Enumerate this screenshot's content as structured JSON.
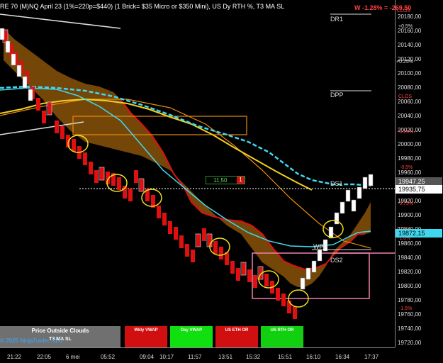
{
  "header": {
    "title": "RE 70 (M)NQ April 23 (1%=220p=$440) (1 Brick= $35 Micro or $350 Mini), US Dy RTH %, T3 MA SL",
    "pnl": "W -1.28% = -269.50"
  },
  "y_axis": {
    "ticks": [
      "20180,00",
      "20160,00",
      "20140,00",
      "20120,00",
      "20100,00",
      "20080,00",
      "20060,00",
      "20040,00",
      "20020,00",
      "20000,00",
      "19980,00",
      "19960,00",
      "19940,00",
      "19920,00",
      "19900,00",
      "19880,00",
      "19860,00",
      "19840,00",
      "19820,00",
      "19800,00",
      "19780,00",
      "19760,00",
      "19740,00",
      "19720,00"
    ]
  },
  "percent_labels": [
    {
      "text": "CLOS",
      "red": true
    },
    {
      "text": "+0.5%",
      "red": false
    },
    {
      "text": "+0.25%",
      "red": false
    },
    {
      "text": "CLOS",
      "red": true
    },
    {
      "text": "-0.25%",
      "red": true
    },
    {
      "text": "-0.5%",
      "red": true
    },
    {
      "text": "-0.75%",
      "red": true
    },
    {
      "text": "CLOS",
      "red": true
    },
    {
      "text": "-1.0%",
      "red": true
    },
    {
      "text": "-1.5%",
      "red": true
    }
  ],
  "pivots": {
    "dr1": "DR1",
    "dpp": "DPP",
    "ds1": "DS1",
    "wpp": "WPP",
    "ds2": "DS2"
  },
  "price_markers": {
    "last": "19947,25",
    "cursor": "19935,75",
    "ma": "19872,15"
  },
  "x_axis": {
    "ticks": [
      "21:22",
      "22:05",
      "6 mei",
      "05:52",
      "09:04",
      "10:17",
      "11:57",
      "13:51",
      "15:32",
      "15:51",
      "16:10",
      "16:34",
      "17:37"
    ]
  },
  "order_qty": {
    "value": "11,50",
    "count": "1"
  },
  "buttons": {
    "price_outside": "Price Outside Clouds",
    "t3ma": "T3 MA SL",
    "wkly_vwap": "Wkly VWAP",
    "day_vwap": "Day VWAP",
    "us_eth_or": "US ETH OR",
    "us_rth_or": "US RTH OR"
  },
  "copyright": "© 2025 NinjaTrader, LLC",
  "colors": {
    "cloud": "#7a4a08",
    "cloud_edge": "#e01010",
    "ma_cyan": "#40d8f0",
    "ma_yellow": "#f0d020",
    "orange": "#e88a10",
    "pink": "#f080b0",
    "down_brick": "#e01010",
    "up_brick": "#ffffff"
  }
}
